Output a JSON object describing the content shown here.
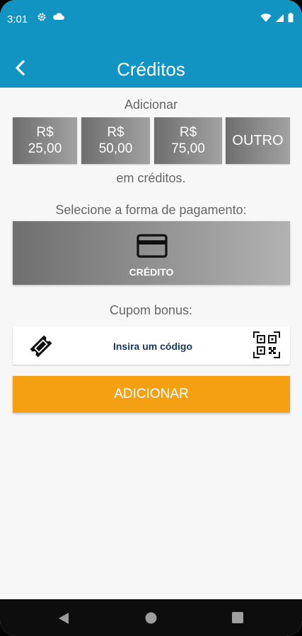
{
  "status": {
    "time": "3:01",
    "left_icons": [
      "gear-icon",
      "cloud-icon"
    ],
    "right_icons": [
      "wifi-icon",
      "signal-icon",
      "battery-icon"
    ]
  },
  "appbar": {
    "title": "Créditos",
    "back_icon": "chevron-left-icon",
    "color": "#1294c2"
  },
  "credits": {
    "add_label": "Adicionar",
    "amounts": [
      {
        "line1": "R$",
        "line2": "25,00"
      },
      {
        "line1": "R$",
        "line2": "50,00"
      },
      {
        "line1": "R$",
        "line2": "75,00"
      },
      {
        "line1": "OUTRO",
        "line2": ""
      }
    ],
    "suffix_label": "em créditos."
  },
  "payment": {
    "select_label": "Selecione a forma de pagamento:",
    "option_label": "CRÉDITO",
    "option_icon": "credit-card-icon"
  },
  "coupon": {
    "label": "Cupom bonus:",
    "placeholder": "Insira um código",
    "ticket_icon": "ticket-icon",
    "qr_icon": "qr-code-icon"
  },
  "add_button": {
    "label": "ADICIONAR",
    "color": "#f5a013"
  },
  "navbar": {
    "icons": [
      "back-nav-icon",
      "home-nav-icon",
      "recents-nav-icon"
    ]
  }
}
